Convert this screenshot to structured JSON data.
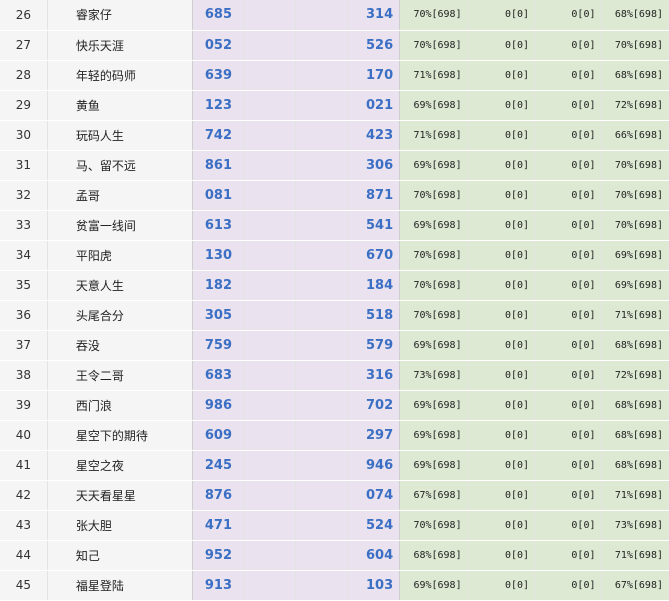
{
  "rows": [
    {
      "rank": "26",
      "name": "睿家仔",
      "num1": "685",
      "num2": "314",
      "pct1": "70%[698]",
      "z1": "0[0]",
      "z2": "0[0]",
      "pct2": "68%[698]"
    },
    {
      "rank": "27",
      "name": "快乐天涯",
      "num1": "052",
      "num2": "526",
      "pct1": "70%[698]",
      "z1": "0[0]",
      "z2": "0[0]",
      "pct2": "70%[698]"
    },
    {
      "rank": "28",
      "name": "年轻的码师",
      "num1": "639",
      "num2": "170",
      "pct1": "71%[698]",
      "z1": "0[0]",
      "z2": "0[0]",
      "pct2": "68%[698]"
    },
    {
      "rank": "29",
      "name": "黄鱼",
      "num1": "123",
      "num2": "021",
      "pct1": "69%[698]",
      "z1": "0[0]",
      "z2": "0[0]",
      "pct2": "72%[698]"
    },
    {
      "rank": "30",
      "name": "玩码人生",
      "num1": "742",
      "num2": "423",
      "pct1": "71%[698]",
      "z1": "0[0]",
      "z2": "0[0]",
      "pct2": "66%[698]"
    },
    {
      "rank": "31",
      "name": "马、留不远",
      "num1": "861",
      "num2": "306",
      "pct1": "69%[698]",
      "z1": "0[0]",
      "z2": "0[0]",
      "pct2": "70%[698]"
    },
    {
      "rank": "32",
      "name": "孟哥",
      "num1": "081",
      "num2": "871",
      "pct1": "70%[698]",
      "z1": "0[0]",
      "z2": "0[0]",
      "pct2": "70%[698]"
    },
    {
      "rank": "33",
      "name": "贫富一线间",
      "num1": "613",
      "num2": "541",
      "pct1": "69%[698]",
      "z1": "0[0]",
      "z2": "0[0]",
      "pct2": "70%[698]"
    },
    {
      "rank": "34",
      "name": "平阳虎",
      "num1": "130",
      "num2": "670",
      "pct1": "70%[698]",
      "z1": "0[0]",
      "z2": "0[0]",
      "pct2": "69%[698]"
    },
    {
      "rank": "35",
      "name": "天意人生",
      "num1": "182",
      "num2": "184",
      "pct1": "70%[698]",
      "z1": "0[0]",
      "z2": "0[0]",
      "pct2": "69%[698]"
    },
    {
      "rank": "36",
      "name": "头尾合分",
      "num1": "305",
      "num2": "518",
      "pct1": "70%[698]",
      "z1": "0[0]",
      "z2": "0[0]",
      "pct2": "71%[698]"
    },
    {
      "rank": "37",
      "name": "吞没",
      "num1": "759",
      "num2": "579",
      "pct1": "69%[698]",
      "z1": "0[0]",
      "z2": "0[0]",
      "pct2": "68%[698]"
    },
    {
      "rank": "38",
      "name": "王令二哥",
      "num1": "683",
      "num2": "316",
      "pct1": "73%[698]",
      "z1": "0[0]",
      "z2": "0[0]",
      "pct2": "72%[698]"
    },
    {
      "rank": "39",
      "name": "西门浪",
      "num1": "986",
      "num2": "702",
      "pct1": "69%[698]",
      "z1": "0[0]",
      "z2": "0[0]",
      "pct2": "68%[698]"
    },
    {
      "rank": "40",
      "name": "星空下的期待",
      "num1": "609",
      "num2": "297",
      "pct1": "69%[698]",
      "z1": "0[0]",
      "z2": "0[0]",
      "pct2": "68%[698]"
    },
    {
      "rank": "41",
      "name": "星空之夜",
      "num1": "245",
      "num2": "946",
      "pct1": "69%[698]",
      "z1": "0[0]",
      "z2": "0[0]",
      "pct2": "68%[698]"
    },
    {
      "rank": "42",
      "name": "天天看星星",
      "num1": "876",
      "num2": "074",
      "pct1": "67%[698]",
      "z1": "0[0]",
      "z2": "0[0]",
      "pct2": "71%[698]"
    },
    {
      "rank": "43",
      "name": "张大胆",
      "num1": "471",
      "num2": "524",
      "pct1": "70%[698]",
      "z1": "0[0]",
      "z2": "0[0]",
      "pct2": "73%[698]"
    },
    {
      "rank": "44",
      "name": "知己",
      "num1": "952",
      "num2": "604",
      "pct1": "68%[698]",
      "z1": "0[0]",
      "z2": "0[0]",
      "pct2": "71%[698]"
    },
    {
      "rank": "45",
      "name": "福星登陆",
      "num1": "913",
      "num2": "103",
      "pct1": "69%[698]",
      "z1": "0[0]",
      "z2": "0[0]",
      "pct2": "67%[698]"
    }
  ]
}
